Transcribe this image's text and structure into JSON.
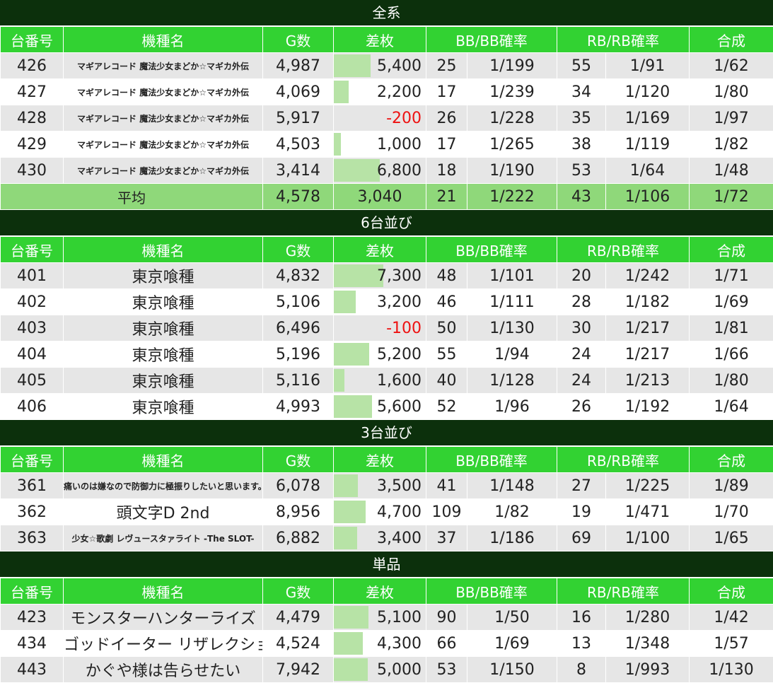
{
  "headers": {
    "no": "台番号",
    "name": "機種名",
    "g": "G数",
    "sa": "差枚",
    "bb": "BB/BB確率",
    "rb": "RB/RB確率",
    "gousei": "合成"
  },
  "sa_scale_max": 7300,
  "colors": {
    "title_bg": "#0c300c",
    "header_bg": "#32d232",
    "avg_bg": "#8fd87a",
    "bar": "#b7e3a6",
    "negative": "#ee1111"
  },
  "sections": [
    {
      "title": "全系",
      "rows": [
        {
          "no": "426",
          "name": "マギアレコード 魔法少女まどか☆マギカ外伝",
          "small": true,
          "g": "4,987",
          "sa": "5,400",
          "sa_value": 5400,
          "bb": "25",
          "bb_prob": "1/199",
          "rb": "55",
          "rb_prob": "1/91",
          "gousei": "1/62"
        },
        {
          "no": "427",
          "name": "マギアレコード 魔法少女まどか☆マギカ外伝",
          "small": true,
          "g": "4,069",
          "sa": "2,200",
          "sa_value": 2200,
          "bb": "17",
          "bb_prob": "1/239",
          "rb": "34",
          "rb_prob": "1/120",
          "gousei": "1/80"
        },
        {
          "no": "428",
          "name": "マギアレコード 魔法少女まどか☆マギカ外伝",
          "small": true,
          "g": "5,917",
          "sa": "-200",
          "sa_value": -200,
          "bb": "26",
          "bb_prob": "1/228",
          "rb": "35",
          "rb_prob": "1/169",
          "gousei": "1/97"
        },
        {
          "no": "429",
          "name": "マギアレコード 魔法少女まどか☆マギカ外伝",
          "small": true,
          "g": "4,503",
          "sa": "1,000",
          "sa_value": 1000,
          "bb": "17",
          "bb_prob": "1/265",
          "rb": "38",
          "rb_prob": "1/119",
          "gousei": "1/82"
        },
        {
          "no": "430",
          "name": "マギアレコード 魔法少女まどか☆マギカ外伝",
          "small": true,
          "g": "3,414",
          "sa": "6,800",
          "sa_value": 6800,
          "bb": "18",
          "bb_prob": "1/190",
          "rb": "53",
          "rb_prob": "1/64",
          "gousei": "1/48"
        }
      ],
      "average": {
        "label": "平均",
        "g": "4,578",
        "sa": "3,040",
        "bb": "21",
        "bb_prob": "1/222",
        "rb": "43",
        "rb_prob": "1/106",
        "gousei": "1/72"
      }
    },
    {
      "title": "6台並び",
      "rows": [
        {
          "no": "401",
          "name": "東京喰種",
          "small": false,
          "g": "4,832",
          "sa": "7,300",
          "sa_value": 7300,
          "bb": "48",
          "bb_prob": "1/101",
          "rb": "20",
          "rb_prob": "1/242",
          "gousei": "1/71"
        },
        {
          "no": "402",
          "name": "東京喰種",
          "small": false,
          "g": "5,106",
          "sa": "3,200",
          "sa_value": 3200,
          "bb": "46",
          "bb_prob": "1/111",
          "rb": "28",
          "rb_prob": "1/182",
          "gousei": "1/69"
        },
        {
          "no": "403",
          "name": "東京喰種",
          "small": false,
          "g": "6,496",
          "sa": "-100",
          "sa_value": -100,
          "bb": "50",
          "bb_prob": "1/130",
          "rb": "30",
          "rb_prob": "1/217",
          "gousei": "1/81"
        },
        {
          "no": "404",
          "name": "東京喰種",
          "small": false,
          "g": "5,196",
          "sa": "5,200",
          "sa_value": 5200,
          "bb": "55",
          "bb_prob": "1/94",
          "rb": "24",
          "rb_prob": "1/217",
          "gousei": "1/66"
        },
        {
          "no": "405",
          "name": "東京喰種",
          "small": false,
          "g": "5,116",
          "sa": "1,600",
          "sa_value": 1600,
          "bb": "40",
          "bb_prob": "1/128",
          "rb": "24",
          "rb_prob": "1/213",
          "gousei": "1/80"
        },
        {
          "no": "406",
          "name": "東京喰種",
          "small": false,
          "g": "4,993",
          "sa": "5,600",
          "sa_value": 5600,
          "bb": "52",
          "bb_prob": "1/96",
          "rb": "26",
          "rb_prob": "1/192",
          "gousei": "1/64"
        }
      ]
    },
    {
      "title": "3台並び",
      "rows": [
        {
          "no": "361",
          "name": "痛いのは嫌なので防御力に極振りしたいと思います。",
          "small": true,
          "g": "6,078",
          "sa": "3,500",
          "sa_value": 3500,
          "bb": "41",
          "bb_prob": "1/148",
          "rb": "27",
          "rb_prob": "1/225",
          "gousei": "1/89"
        },
        {
          "no": "362",
          "name": "頭文字D 2nd",
          "small": false,
          "g": "8,956",
          "sa": "4,700",
          "sa_value": 4700,
          "bb": "109",
          "bb_prob": "1/82",
          "rb": "19",
          "rb_prob": "1/471",
          "gousei": "1/70"
        },
        {
          "no": "363",
          "name": "少女☆歌劇 レヴュースタァライト -The SLOT-",
          "small": true,
          "g": "6,882",
          "sa": "3,400",
          "sa_value": 3400,
          "bb": "37",
          "bb_prob": "1/186",
          "rb": "69",
          "rb_prob": "1/100",
          "gousei": "1/65"
        }
      ]
    },
    {
      "title": "単品",
      "rows": [
        {
          "no": "423",
          "name": "モンスターハンターライズ",
          "small": false,
          "g": "4,479",
          "sa": "5,100",
          "sa_value": 5100,
          "bb": "90",
          "bb_prob": "1/50",
          "rb": "16",
          "rb_prob": "1/280",
          "gousei": "1/42"
        },
        {
          "no": "434",
          "name": "ゴッドイーター リザレクション",
          "small": false,
          "g": "4,524",
          "sa": "4,300",
          "sa_value": 4300,
          "bb": "66",
          "bb_prob": "1/69",
          "rb": "13",
          "rb_prob": "1/348",
          "gousei": "1/57"
        },
        {
          "no": "443",
          "name": "かぐや様は告らせたい",
          "small": false,
          "g": "7,942",
          "sa": "5,000",
          "sa_value": 5000,
          "bb": "53",
          "bb_prob": "1/150",
          "rb": "8",
          "rb_prob": "1/993",
          "gousei": "1/130"
        }
      ]
    }
  ]
}
